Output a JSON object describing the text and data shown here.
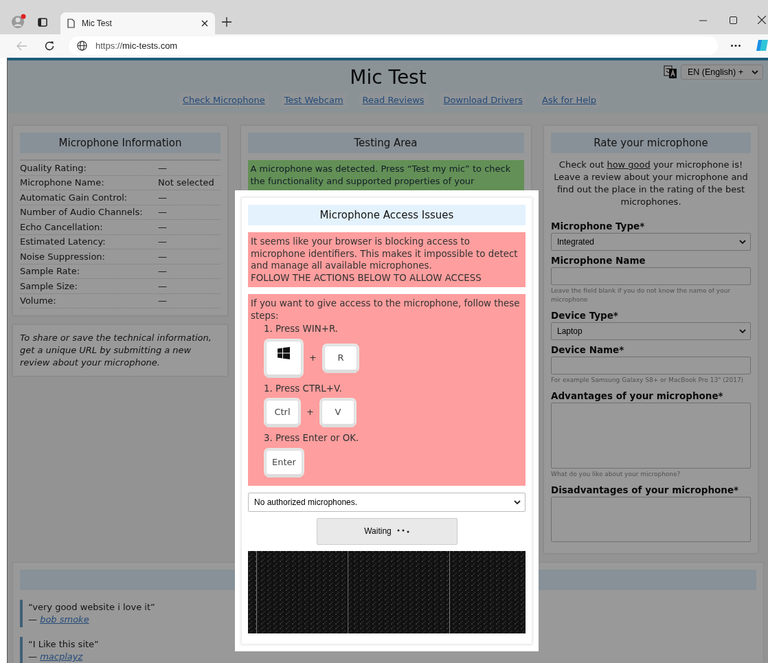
{
  "browser": {
    "tab_title": "Mic Test",
    "url_scheme": "https://",
    "url_host": "mic-tests.com"
  },
  "header": {
    "title": "Mic Test",
    "language": "EN (English) +",
    "nav": [
      "Check Microphone",
      "Test Webcam",
      "Read Reviews",
      "Download Drivers",
      "Ask for Help"
    ]
  },
  "info_panel": {
    "title": "Microphone Information",
    "rows": [
      {
        "label": "Quality Rating:",
        "value": "—"
      },
      {
        "label": "Microphone Name:",
        "value": "Not selected"
      },
      {
        "label": "Automatic Gain Control:",
        "value": "—"
      },
      {
        "label": "Number of Audio Channels:",
        "value": "—"
      },
      {
        "label": "Echo Cancellation:",
        "value": "—"
      },
      {
        "label": "Estimated Latency:",
        "value": "—"
      },
      {
        "label": "Noise Suppression:",
        "value": "—"
      },
      {
        "label": "Sample Rate:",
        "value": "—"
      },
      {
        "label": "Sample Size:",
        "value": "—"
      },
      {
        "label": "Volume:",
        "value": "—"
      }
    ],
    "note": "To share or save the technical information, get a unique URL by submitting a new review about your microphone."
  },
  "testing_area": {
    "title": "Testing Area",
    "message": "A microphone was detected. Press “Test my mic” to check the functionality and supported properties of your"
  },
  "rate_panel": {
    "title": "Rate your microphone",
    "intro_before": "Check out",
    "intro_link": "how good",
    "intro_after": "your microphone is! Leave a review about your microphone and find out the place in the rating of the best microphones.",
    "fields": [
      {
        "kind": "select",
        "label": "Microphone Type*",
        "value": "Integrated"
      },
      {
        "kind": "input",
        "label": "Microphone Name",
        "hint": "Leave the field blank if you do not know the name of your microphone"
      },
      {
        "kind": "select",
        "label": "Device Type*",
        "value": "Laptop"
      },
      {
        "kind": "input",
        "label": "Device Name*",
        "hint": "For example Samsung Galaxy S8+ or MacBook Pro 13\" (2017)"
      },
      {
        "kind": "textarea",
        "label": "Advantages of your microphone*",
        "hint": "What do you like about your microphone?"
      },
      {
        "kind": "textarea",
        "label": "Disadvantages of your microphone*"
      }
    ]
  },
  "reviews": [
    {
      "quote": "“very good website i love it”",
      "dash": "—",
      "author": "bob smoke"
    },
    {
      "quote": "“I Like this site”",
      "dash": "—",
      "author": "macplayz"
    }
  ],
  "modal": {
    "title": "Microphone Access Issues",
    "warning": "It seems like your browser is blocking access to microphone identifiers. This makes it impossible to detect and manage all available microphones.",
    "warning_caps": "FOLLOW THE ACTIONS BELOW TO ALLOW ACCESS",
    "intro": "If you want to give access to the microphone, follow these steps:",
    "steps": [
      {
        "text": "1. Press WIN+R.",
        "keys": [
          {
            "kind": "windows"
          },
          {
            "kind": "text",
            "label": "R"
          }
        ],
        "plus": "+"
      },
      {
        "text": "1. Press CTRL+V.",
        "keys": [
          {
            "kind": "text",
            "label": "Ctrl"
          },
          {
            "kind": "text",
            "label": "V"
          }
        ],
        "plus": "+"
      },
      {
        "text": "3. Press Enter or OK.",
        "keys": [
          {
            "kind": "text",
            "label": "Enter"
          }
        ]
      }
    ],
    "device_select": "No authorized microphones.",
    "button": "Waiting"
  }
}
